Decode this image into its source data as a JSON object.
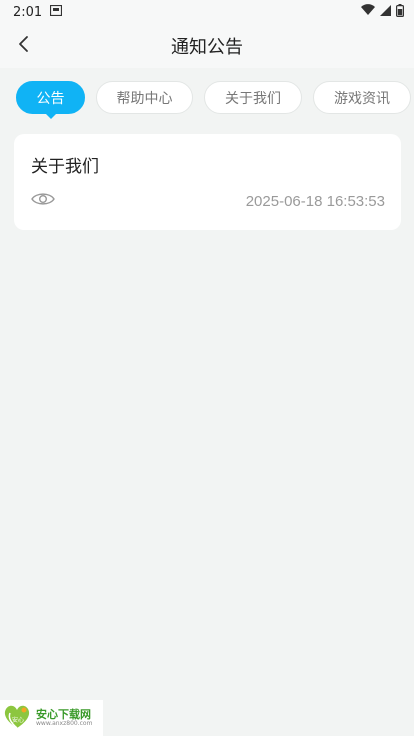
{
  "status": {
    "time": "2:01"
  },
  "header": {
    "title": "通知公告"
  },
  "tabs": [
    {
      "label": "公告",
      "active": true
    },
    {
      "label": "帮助中心",
      "active": false
    },
    {
      "label": "关于我们",
      "active": false
    },
    {
      "label": "游戏资讯",
      "active": false
    }
  ],
  "articles": [
    {
      "title": "关于我们",
      "date": "2025-06-18 16:53:53"
    }
  ],
  "watermark": {
    "title": "安心下载网",
    "url": "www.anxz800.com",
    "logo_text": "安心"
  },
  "colors": {
    "accent": "#10b3f5",
    "background": "#f2f4f3"
  }
}
